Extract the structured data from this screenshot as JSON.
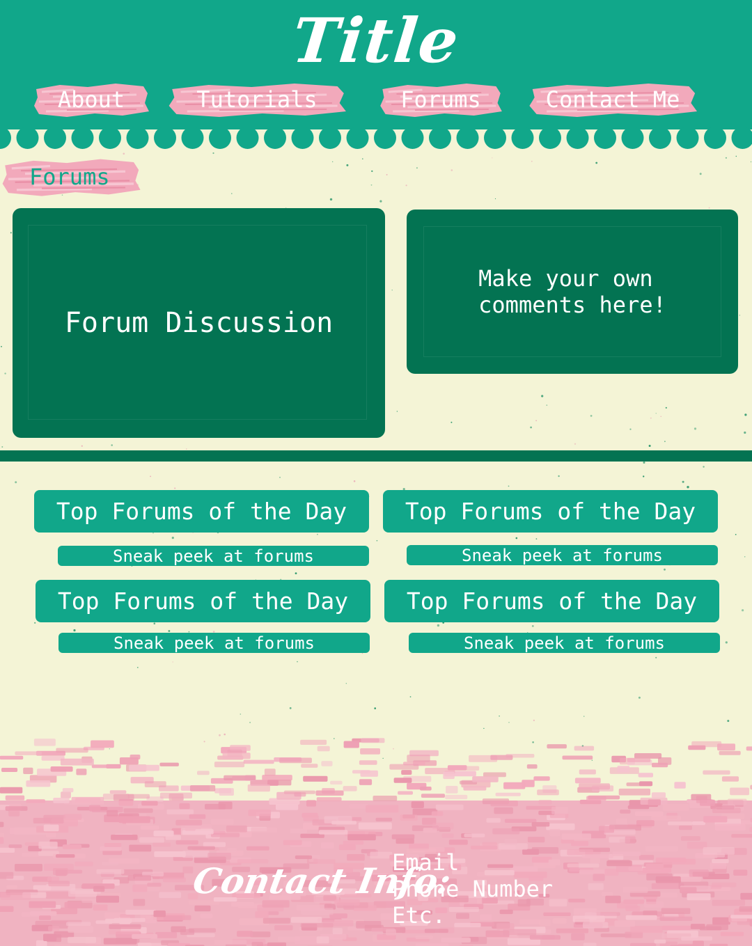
{
  "header": {
    "title": "Title"
  },
  "nav": {
    "items": [
      {
        "label": "About"
      },
      {
        "label": "Tutorials"
      },
      {
        "label": "Forums"
      },
      {
        "label": "Contact Me"
      }
    ]
  },
  "breadcrumb": {
    "label": "Forums"
  },
  "panels": {
    "discussion": "Forum Discussion",
    "comments": "Make your own\ncomments here!"
  },
  "forums": [
    {
      "title": "Top Forums of the Day",
      "subtitle": "Sneak peek at forums"
    },
    {
      "title": "Top Forums of the Day",
      "subtitle": "Sneak peek at forums"
    },
    {
      "title": "Top Forums of the Day",
      "subtitle": "Sneak peek at forums"
    },
    {
      "title": "Top Forums of the Day",
      "subtitle": "Sneak peek at forums"
    }
  ],
  "footer": {
    "heading": "Contact Info:",
    "lines": [
      "Email",
      "Phone Number",
      "Etc."
    ]
  },
  "colors": {
    "header_green": "#11a78a",
    "panel_green": "#037352",
    "cream": "#f4f4d6",
    "brush_pink": "#f2a9bb"
  },
  "icons": {
    "nav_background": "pink-brush-stroke",
    "footer_background": "pink-brush-pattern"
  }
}
